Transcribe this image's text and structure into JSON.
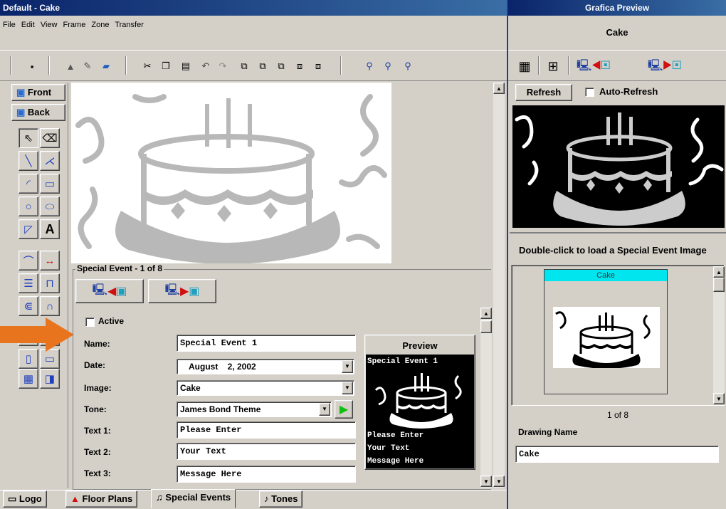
{
  "main_window": {
    "title": "Default - Cake",
    "menu": [
      "File",
      "Edit",
      "View",
      "Frame",
      "Zone",
      "Transfer"
    ]
  },
  "preview_window": {
    "title": "Grafica Preview",
    "subtitle": "Cake",
    "refresh_label": "Refresh",
    "auto_refresh_label": "Auto-Refresh",
    "auto_refresh_checked": false,
    "instruction": "Double-click to load a Special Event Image",
    "thumbnail_title": "Cake",
    "counter": "1 of 8",
    "drawing_name_label": "Drawing Name",
    "drawing_name_value": "Cake"
  },
  "side_tools": {
    "front_label": "Front",
    "back_label": "Back"
  },
  "special_event": {
    "group_title": "Special Event - 1 of 8",
    "active_label": "Active",
    "active_checked": false,
    "name_label": "Name:",
    "name_value": "Special Event 1",
    "date_label": "Date:",
    "date_value": "August    2, 2002",
    "image_label": "Image:",
    "image_value": "Cake",
    "tone_label": "Tone:",
    "tone_value": "James Bond Theme",
    "text1_label": "Text 1:",
    "text1_value": "Please Enter",
    "text2_label": "Text 2:",
    "text2_value": "Your Text",
    "text3_label": "Text 3:",
    "text3_value": "Message Here",
    "preview_label": "Preview",
    "preview_line1": "Special Event 1",
    "preview_line2": "Please Enter",
    "preview_line3": "Your Text",
    "preview_line4": "Message Here"
  },
  "bottom_tabs": [
    "Logo",
    "Floor Plans",
    "Special Events",
    "Tones"
  ],
  "colors": {
    "desktop": "#1d3e9a",
    "window_face": "#d4d0c8",
    "cake_gray": "#b8b8b8",
    "thumb_header": "#00e5ee",
    "callout_arrow": "#e8741e"
  }
}
